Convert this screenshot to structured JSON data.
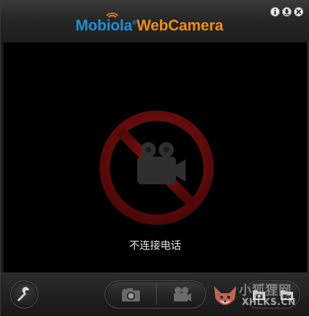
{
  "app": {
    "brand": "Mobiola",
    "reg_mark": "®",
    "product": "WebCamera"
  },
  "window_buttons": [
    {
      "name": "info",
      "icon": "info-icon"
    },
    {
      "name": "minimize",
      "icon": "download-arrow-icon"
    },
    {
      "name": "close",
      "icon": "close-icon"
    }
  ],
  "video": {
    "overlay_icon": "no-camera-icon",
    "status_text": "不连接电话"
  },
  "toolbar": {
    "settings_icon": "wrench-icon",
    "capture_photo_icon": "camera-icon",
    "record_video_icon": "video-camera-icon",
    "open_photos_icon": "photo-folder-icon",
    "open_videos_icon": "video-folder-icon"
  },
  "watermark": {
    "text_cn": "小狐狸网",
    "text_en": "XHLKS.CN"
  },
  "colors": {
    "brand_blue": "#1e8fd6",
    "brand_orange": "#f08c1b",
    "prohibit_red": "#6e0c0c"
  }
}
